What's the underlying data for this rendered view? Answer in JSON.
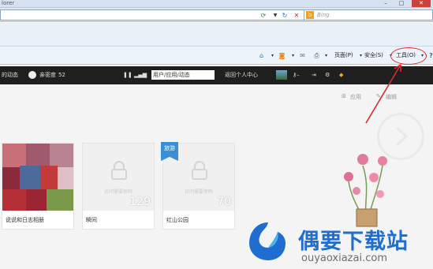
{
  "window": {
    "title_fragment": "lorer"
  },
  "search": {
    "placeholder": "Bing"
  },
  "commandbar": {
    "page_label": "页面(P)",
    "safety_label": "安全(S)",
    "tools_label": "工具(O)"
  },
  "site": {
    "feed_label": "的动态",
    "intimacy_label": "亲密度",
    "intimacy_value": "52",
    "search_value": "用户/应用/动态",
    "back_home": "返回个人中心"
  },
  "content": {
    "apps_label": "应用",
    "edit_label": "编辑",
    "locked_hint": "访问需要密码",
    "albums": [
      {
        "name": "说说和日志相册",
        "count": "",
        "locked": false
      },
      {
        "name": "瞬间",
        "count": "129",
        "locked": true
      },
      {
        "name": "红山公园",
        "count": "70",
        "locked": true,
        "tag": "旅游"
      }
    ]
  },
  "watermark": {
    "title": "偶要下载站",
    "url": "ouyaoxiazai.com"
  },
  "colors": {
    "annotation": "#e0282a",
    "watermark_blue": "#1f6dd0",
    "site_bar": "#1f1f1f"
  }
}
